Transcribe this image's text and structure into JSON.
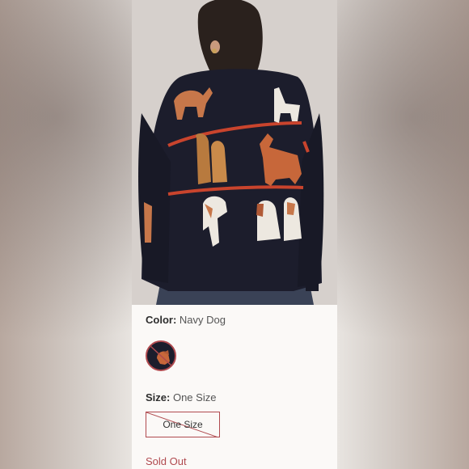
{
  "product": {
    "color_label": "Color:",
    "color_value": "Navy Dog",
    "size_label": "Size:",
    "size_value": "One Size",
    "size_option": "One Size",
    "availability": "Sold Out"
  },
  "colors": {
    "accent": "#b04a4f",
    "sweater": "#1c1d2c",
    "stripe": "#c9442d"
  }
}
